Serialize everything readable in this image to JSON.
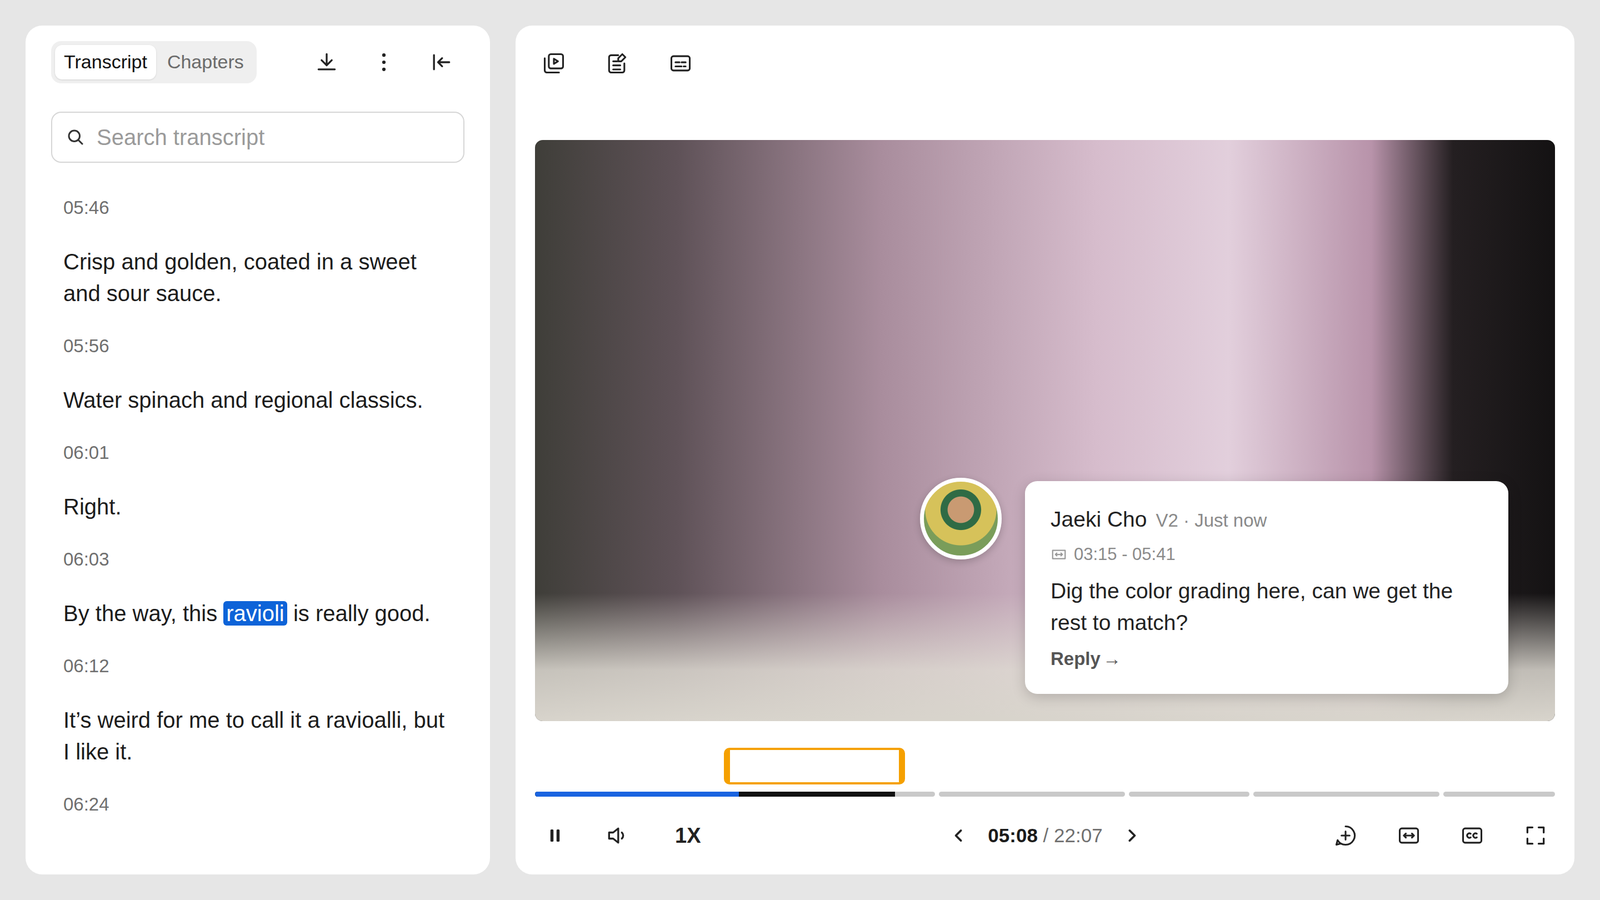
{
  "sidebar": {
    "tabs": [
      {
        "label": "Transcript",
        "selected": true
      },
      {
        "label": "Chapters",
        "selected": false
      }
    ],
    "search": {
      "placeholder": "Search transcript"
    },
    "transcript": [
      {
        "time": "05:46",
        "parts": [
          {
            "text": "Crisp and golden, coated in a sweet and sour sauce.",
            "highlighted": false
          }
        ]
      },
      {
        "time": "05:56",
        "parts": [
          {
            "text": "Water spinach and regional classics.",
            "highlighted": false
          }
        ]
      },
      {
        "time": "06:01",
        "parts": [
          {
            "text": "Right.",
            "highlighted": false
          }
        ]
      },
      {
        "time": "06:03",
        "parts": [
          {
            "text": "By the way, this",
            "highlighted": false
          },
          {
            "text": "ravioli",
            "highlighted": true
          },
          {
            "text": "is really good.",
            "highlighted": false
          }
        ]
      },
      {
        "time": "06:12",
        "parts": [
          {
            "text": "It’s weird for me to call it a ravioalli, but I like it.",
            "highlighted": false
          }
        ]
      },
      {
        "time": "06:24",
        "parts": []
      }
    ]
  },
  "comment": {
    "author": "Jaeki Cho",
    "meta": "V2 · Just now",
    "range": "03:15 - 05:41",
    "body": "Dig the color grading here, can we get the rest to match?",
    "reply": "Reply",
    "reply_arrow": "→"
  },
  "player": {
    "playing": true,
    "speed": "1X",
    "current": "05:08",
    "separator": "/",
    "duration": "22:07",
    "chapters": [
      {
        "played": 0.51,
        "buffered": 0.9
      },
      {
        "played": 0,
        "buffered": 0
      },
      {
        "played": 0,
        "buffered": 0
      },
      {
        "played": 0,
        "buffered": 0
      },
      {
        "played": 0,
        "buffered": 0
      }
    ]
  }
}
